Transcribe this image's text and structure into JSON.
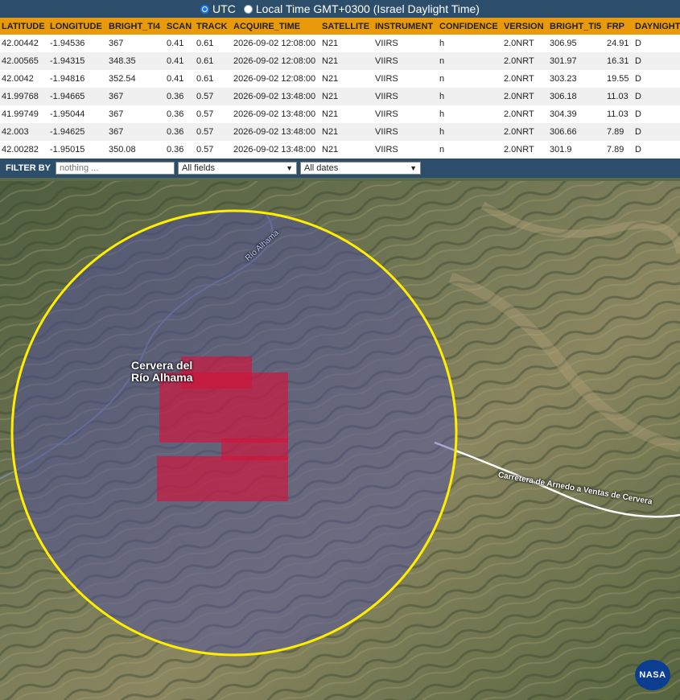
{
  "timebar": {
    "utc_label": "UTC",
    "local_label": "Local Time GMT+0300 (Israel Daylight Time)"
  },
  "table": {
    "columns": [
      "LATITUDE",
      "LONGITUDE",
      "BRIGHT_TI4",
      "SCAN",
      "TRACK",
      "ACQUIRE_TIME",
      "SATELLITE",
      "INSTRUMENT",
      "CONFIDENCE",
      "VERSION",
      "BRIGHT_TI5",
      "FRP",
      "DAYNIGHT"
    ],
    "rows": [
      [
        "42.00442",
        "-1.94536",
        "367",
        "0.41",
        "0.61",
        "2026-09-02 12:08:00",
        "N21",
        "VIIRS",
        "h",
        "2.0NRT",
        "306.95",
        "24.91",
        "D"
      ],
      [
        "42.00565",
        "-1.94315",
        "348.35",
        "0.41",
        "0.61",
        "2026-09-02 12:08:00",
        "N21",
        "VIIRS",
        "n",
        "2.0NRT",
        "301.97",
        "16.31",
        "D"
      ],
      [
        "42.0042",
        "-1.94816",
        "352.54",
        "0.41",
        "0.61",
        "2026-09-02 12:08:00",
        "N21",
        "VIIRS",
        "n",
        "2.0NRT",
        "303.23",
        "19.55",
        "D"
      ],
      [
        "41.99768",
        "-1.94665",
        "367",
        "0.36",
        "0.57",
        "2026-09-02 13:48:00",
        "N21",
        "VIIRS",
        "h",
        "2.0NRT",
        "306.18",
        "11.03",
        "D"
      ],
      [
        "41.99749",
        "-1.95044",
        "367",
        "0.36",
        "0.57",
        "2026-09-02 13:48:00",
        "N21",
        "VIIRS",
        "h",
        "2.0NRT",
        "304.39",
        "11.03",
        "D"
      ],
      [
        "42.003",
        "-1.94625",
        "367",
        "0.36",
        "0.57",
        "2026-09-02 13:48:00",
        "N21",
        "VIIRS",
        "h",
        "2.0NRT",
        "306.66",
        "7.89",
        "D"
      ],
      [
        "42.00282",
        "-1.95015",
        "350.08",
        "0.36",
        "0.57",
        "2026-09-02 13:48:00",
        "N21",
        "VIIRS",
        "n",
        "2.0NRT",
        "301.9",
        "7.89",
        "D"
      ]
    ]
  },
  "filter": {
    "label": "FILTER BY",
    "placeholder": "nothing ...",
    "field_select": "All fields",
    "date_select": "All dates"
  },
  "map": {
    "town_label_line1": "Cervera del",
    "town_label_line2": "Río Alhama",
    "river_label": "Río Alhama",
    "road_label": "Carretera de Arnedo a Ventas de Cervera",
    "logo_text": "NASA",
    "colors": {
      "circle": "#ffee00",
      "fire": "#d2143c",
      "overlay": "#5050a0"
    }
  }
}
